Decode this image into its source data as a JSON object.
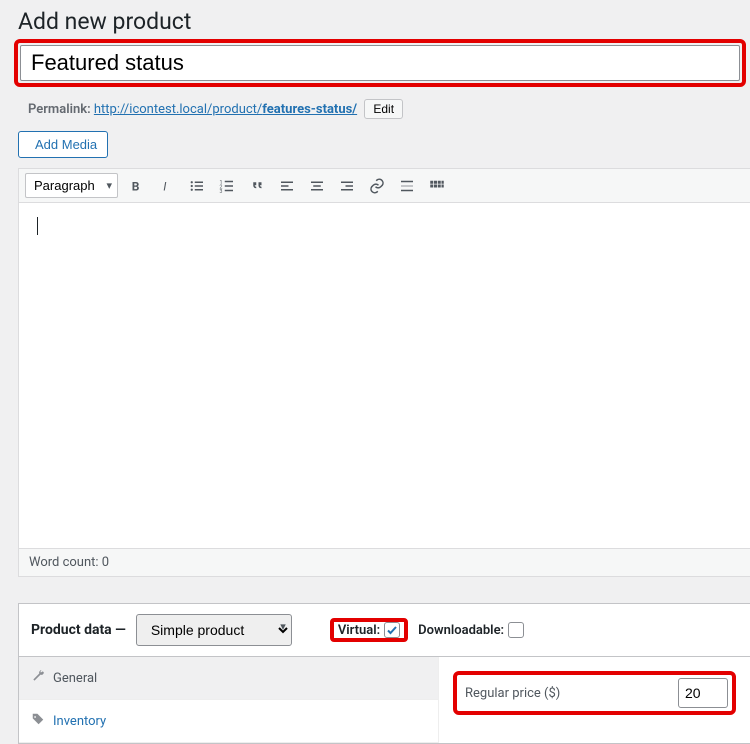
{
  "page": {
    "title": "Add new product"
  },
  "product": {
    "title": "Featured status"
  },
  "permalink": {
    "label": "Permalink:",
    "base": "http://icontest.local/product/",
    "slug": "features-status/",
    "edit": "Edit"
  },
  "buttons": {
    "add_media": "Add Media"
  },
  "toolbar": {
    "format": "Paragraph"
  },
  "editor": {
    "word_count_label": "Word count: ",
    "word_count": "0"
  },
  "product_data": {
    "title": "Product data —",
    "type": "Simple product",
    "virtual_label": "Virtual:",
    "virtual_checked": true,
    "downloadable_label": "Downloadable:",
    "downloadable_checked": false,
    "tabs": {
      "general": "General",
      "inventory": "Inventory"
    },
    "fields": {
      "regular_price_label": "Regular price ($)",
      "regular_price_value": "20"
    }
  }
}
